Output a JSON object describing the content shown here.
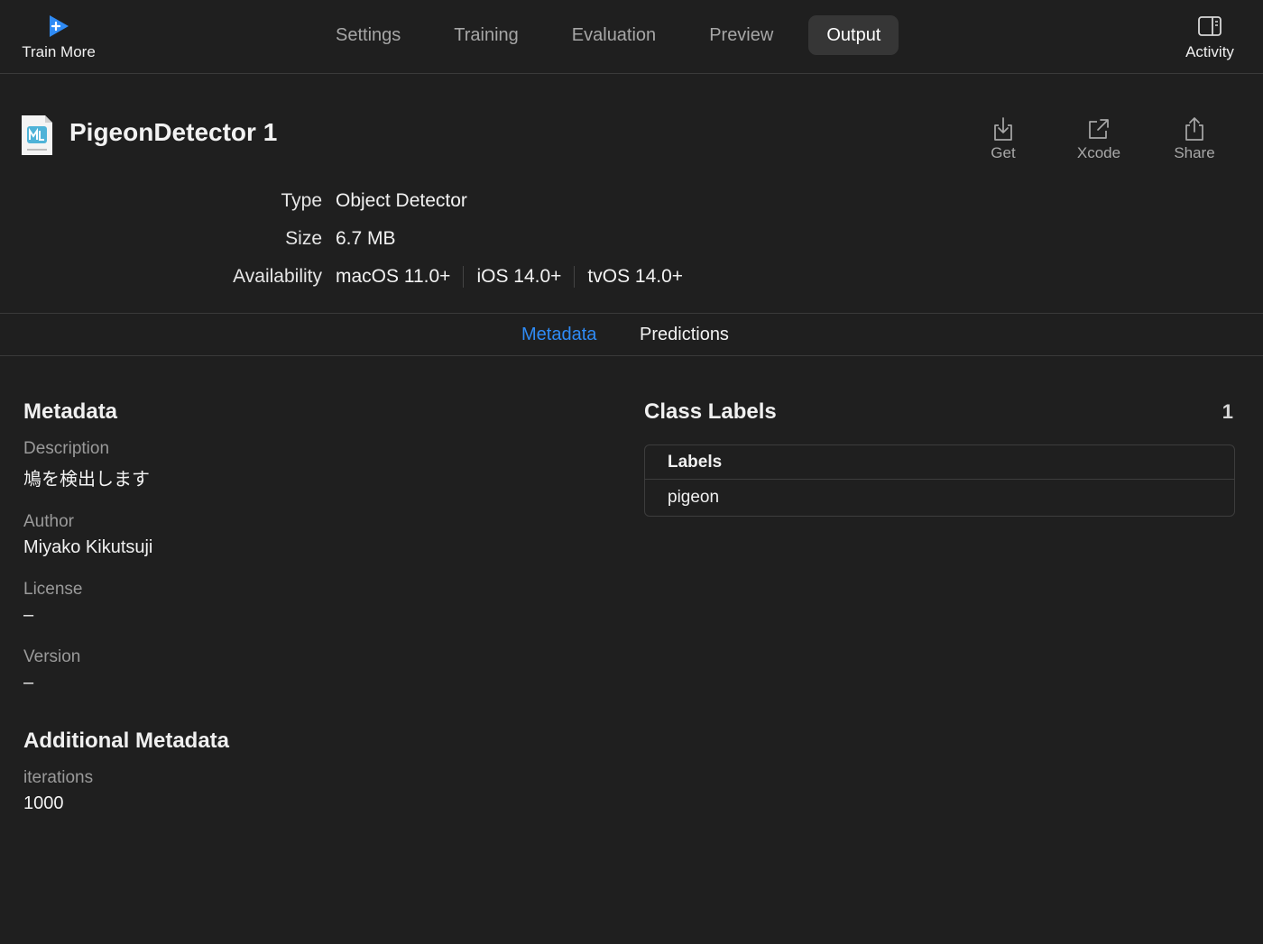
{
  "toolbar": {
    "train_more_label": "Train More",
    "tabs": [
      {
        "label": "Settings"
      },
      {
        "label": "Training"
      },
      {
        "label": "Evaluation"
      },
      {
        "label": "Preview"
      },
      {
        "label": "Output"
      }
    ],
    "active_tab": "Output",
    "activity_label": "Activity",
    "accent_color": "#2f8bf5"
  },
  "model": {
    "name": "PigeonDetector 1",
    "icon": "ml-model-file-icon",
    "icon_caption": "ML MODEL",
    "actions": [
      {
        "label": "Get",
        "icon": "download-icon"
      },
      {
        "label": "Xcode",
        "icon": "open-external-icon"
      },
      {
        "label": "Share",
        "icon": "share-icon"
      }
    ]
  },
  "info": {
    "type_label": "Type",
    "type_value": "Object Detector",
    "size_label": "Size",
    "size_value": "6.7 MB",
    "availability_label": "Availability",
    "availability": [
      "macOS 11.0+",
      "iOS 14.0+",
      "tvOS 14.0+"
    ]
  },
  "segments": {
    "metadata": "Metadata",
    "predictions": "Predictions",
    "active": "Metadata"
  },
  "metadata": {
    "title": "Metadata",
    "fields": [
      {
        "label": "Description",
        "value": "鳩を検出します"
      },
      {
        "label": "Author",
        "value": "Miyako Kikutsuji"
      },
      {
        "label": "License",
        "value": "–"
      },
      {
        "label": "Version",
        "value": "–"
      }
    ]
  },
  "additional_metadata": {
    "title": "Additional Metadata",
    "fields": [
      {
        "label": "iterations",
        "value": "1000"
      }
    ]
  },
  "class_labels": {
    "title": "Class Labels",
    "count": "1",
    "header": "Labels",
    "rows": [
      "pigeon"
    ]
  }
}
